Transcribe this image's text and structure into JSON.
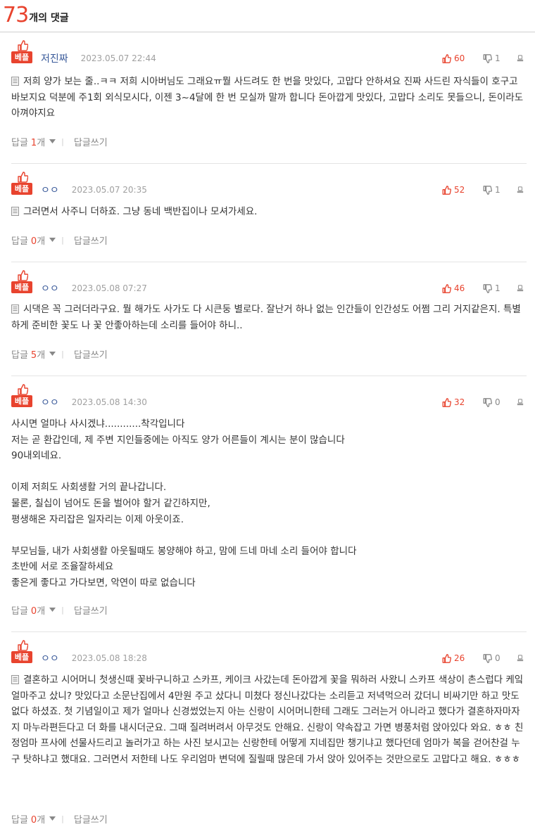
{
  "header": {
    "count": "73",
    "count_label": "개의 댓글"
  },
  "colors": {
    "accent": "#e8432e",
    "author": "#3a5a9a",
    "muted": "#a0a0a0"
  },
  "icons": {
    "best": "thumbs-up-icon",
    "up": "thumbs-up-icon",
    "down": "thumbs-down-icon",
    "report": "report-icon",
    "doc": "document-icon",
    "reply_toggle": "chevron-down-icon"
  },
  "labels": {
    "best": "베플",
    "reply": "답글",
    "reply_unit": "개",
    "write_reply": "답글쓰기"
  },
  "comments": [
    {
      "author": "저진짜",
      "date": "2023.05.07 22:44",
      "up": "60",
      "down": "1",
      "has_doc_icon": true,
      "text": "저희 양가 보는 줄..ㅋㅋ 저희 시아버님도 그래요ㅠ뭘 사드려도 한 번을 맛있다, 고맙다 안하셔요 진짜 사드린 자식들이 호구고 바보지요 덕분에 주1회 외식모시다, 이젠 3~4달에 한 번 모실까 말까 합니다 돈아깝게 맛있다, 고맙다 소리도 못들으니, 돈이라도 아껴야지요",
      "reply_count": "1"
    },
    {
      "author": "ㅇㅇ",
      "date": "2023.05.07 20:35",
      "up": "52",
      "down": "1",
      "has_doc_icon": true,
      "text": "그러면서 사주니 더하죠. 그냥 동네 백반집이나 모셔가세요.",
      "reply_count": "0"
    },
    {
      "author": "ㅇㅇ",
      "date": "2023.05.08 07:27",
      "up": "46",
      "down": "1",
      "has_doc_icon": true,
      "text": "시댁은 꼭 그러더라구요. 뭘 해가도 사가도 다 시큰둥 별로다. 잘난거 하나 없는 인간들이 인간성도 어쩜 그리 거지같은지. 특별하게 준비한 꽃도 나 꽃 안좋아하는데 소리를 들어야 하니..",
      "reply_count": "5"
    },
    {
      "author": "ㅇㅇ",
      "date": "2023.05.08 14:30",
      "up": "32",
      "down": "0",
      "has_doc_icon": false,
      "text": "사시면 얼마나 사시겠냐............착각입니다\n저는 곧 환갑인데, 제 주변 지인들중에는 아직도 양가 어른들이 계시는 분이 많습니다\n90내외네요.\n\n이제 저희도 사회생활 거의 끝나갑니다.\n물론, 칠십이 넘어도 돈을 벌어야 할거 같긴하지만,\n평생해온 자리잡은 일자리는 이제 아웃이죠.\n\n부모님들, 내가 사회생활 아웃될때도 봉양해야 하고, 맘에 드네 마네 소리 들어야 합니다\n초반에 서로 조율잘하세요\n좋은게 좋다고 가다보면, 악연이 따로 없습니다",
      "reply_count": "0"
    },
    {
      "author": "ㅇㅇ",
      "date": "2023.05.08 18:28",
      "up": "26",
      "down": "0",
      "has_doc_icon": true,
      "text": "결혼하고 시어머니 첫생신때 꽃바구니하고 스카프, 케이크 사갔는데 돈아깝게 꽃을 뭐하러 사왔니 스카프 색상이 촌스럽다 케잌 얼마주고 샀니? 맛있다고 소문난집에서 4만원 주고 샀다니 미쳤다 정신나갔다는 소리듣고 저녁먹으러 갔더니 비싸기만 하고 맛도 없다 하셨죠. 첫 기념일이고 제가 얼마나 신경썼었는지 아는 신랑이 시어머니한테 그래도 그러는거 아니라고 했다가 결혼하자마자 지 마누라편든다고 더 화를 내시더군요. 그때 질려버려서 아무것도 안해요. 신랑이 약속잡고 가면 병풍처럼 앉아있다 와요. ㅎㅎ 친정엄마 프사에 선물사드리고 놀러가고 하는 사진 보시고는 신랑한테 어떻게 지네집만 챙기냐고 했다던데 엄마가 복을 걷어찬걸 누구 탓하냐고 했대요. 그러면서 저한테 나도 우리엄마 변덕에 질릴때 많은데 가서 앉아 있어주는 것만으로도 고맙다고 해요. ㅎㅎㅎ",
      "reply_count": "0"
    }
  ]
}
